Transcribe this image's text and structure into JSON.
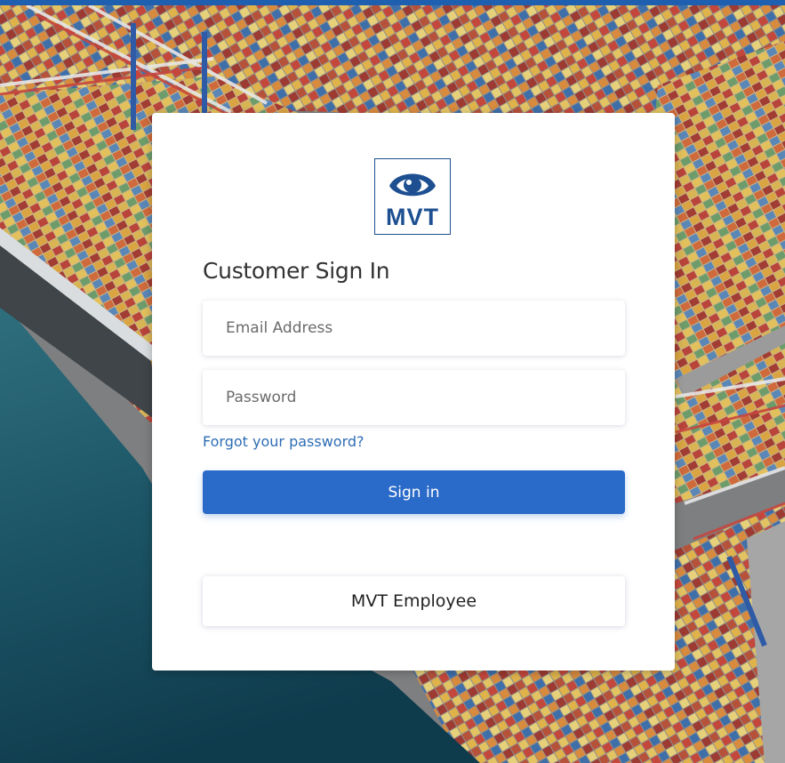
{
  "brand": {
    "logo_text": "MVT",
    "color": "#1d4f91"
  },
  "signin_form": {
    "title": "Customer Sign In",
    "email_placeholder": "Email Address",
    "password_placeholder": "Password",
    "forgot_link": "Forgot your password?",
    "signin_button": "Sign in",
    "employee_button": "MVT Employee"
  },
  "colors": {
    "accent": "#2a6ac8",
    "link": "#2e6db4",
    "top_bar": "#1f5fb0"
  },
  "background": {
    "subject": "port-container-terminal-aerial-photo"
  }
}
